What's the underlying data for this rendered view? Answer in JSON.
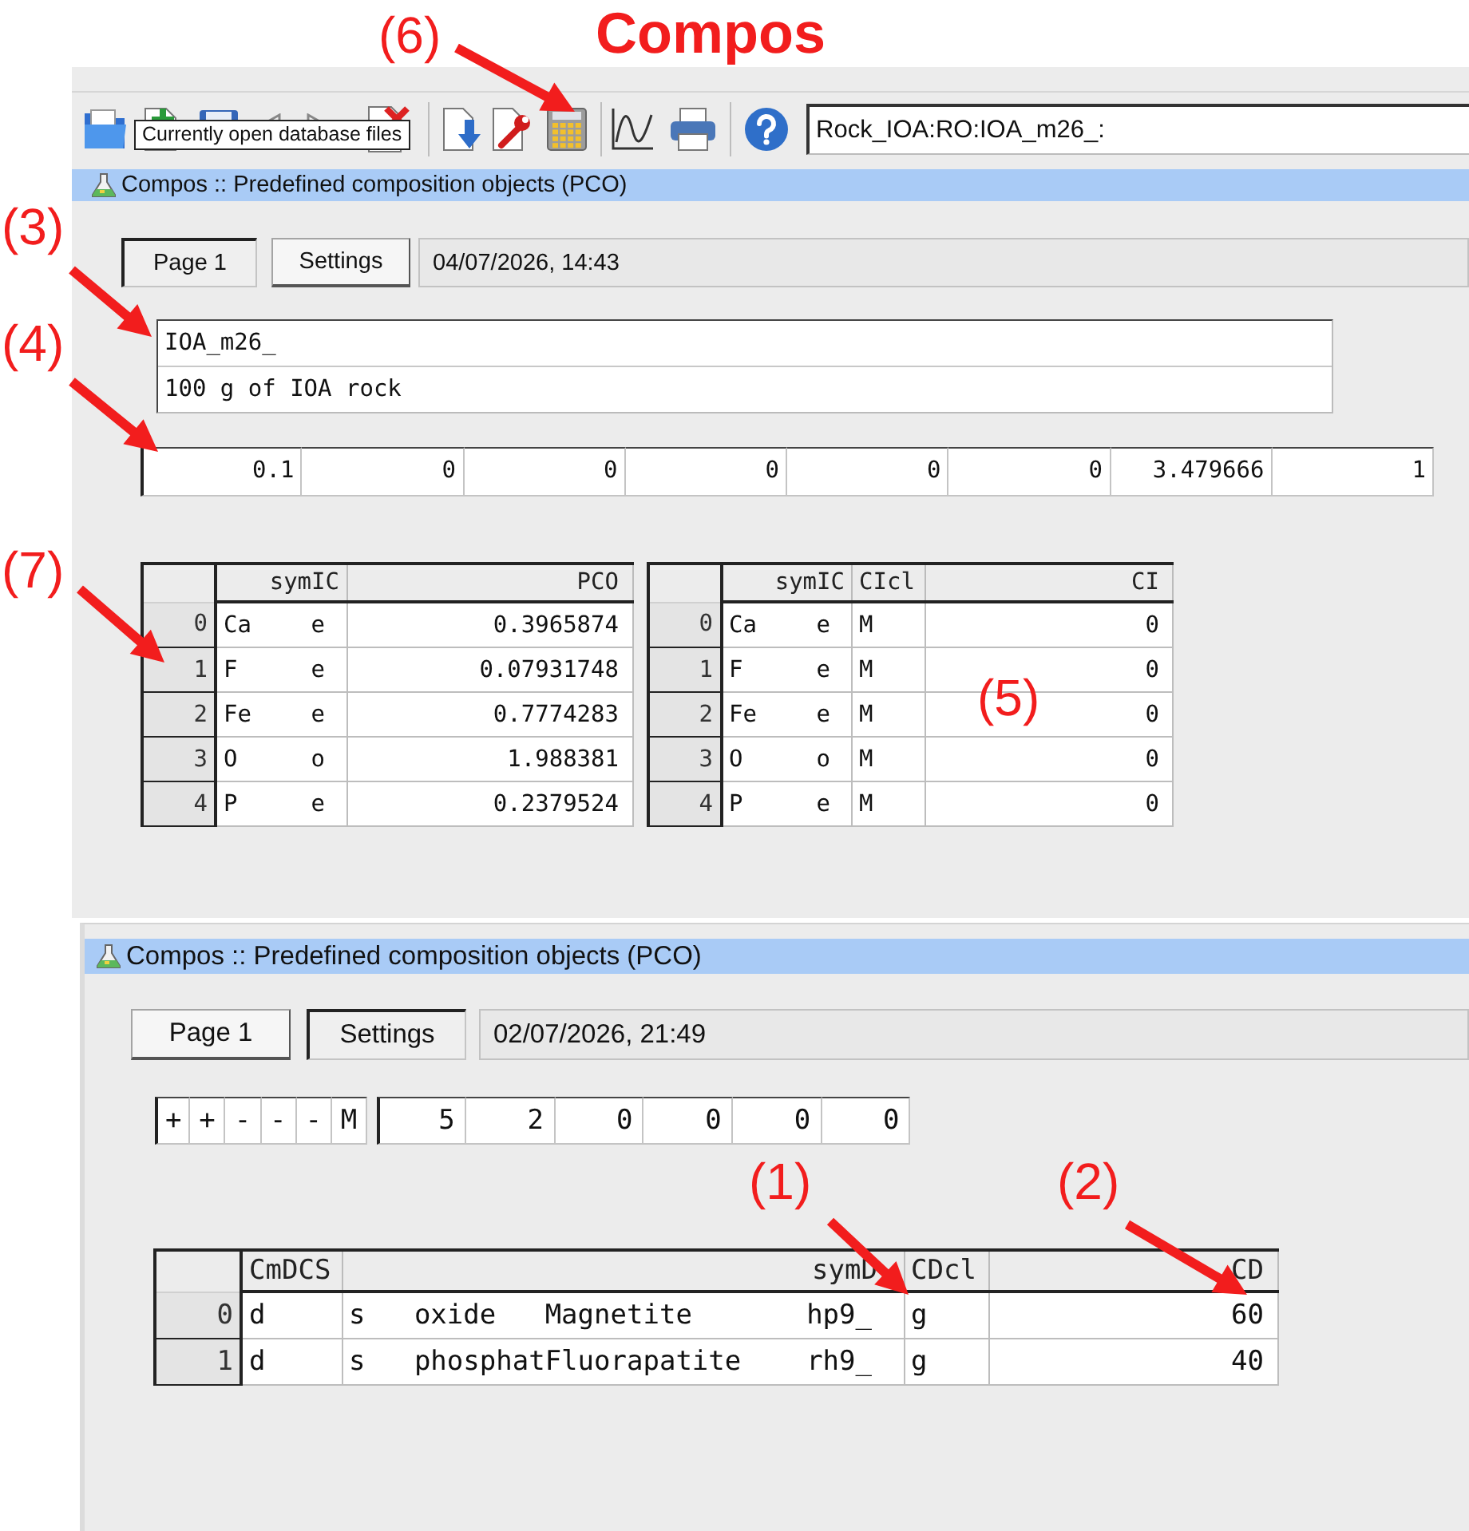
{
  "heading": "Compos",
  "windows": [
    {
      "toolbar": {
        "tooltip": "Currently open database files",
        "path": "Rock_IOA:RO:IOA_m26_:"
      },
      "title": "Compos :: Predefined composition objects (PCO)",
      "tabs": [
        {
          "label": "Page 1",
          "selected": true
        },
        {
          "label": "Settings",
          "selected": false
        }
      ],
      "timestamp": "04/07/2026, 14:43",
      "record_name": "IOA_m26_",
      "comment": "100 g of IOA rock",
      "values": [
        "0.1",
        "0",
        "0",
        "0",
        "0",
        "0",
        "3.479666",
        "1"
      ],
      "tables": [
        {
          "columns": [
            {
              "label": "symIC",
              "kind": "pair"
            },
            {
              "label": "PCO",
              "kind": "number"
            }
          ],
          "rows": [
            {
              "index": "0",
              "cells": [
                [
                  "Ca",
                  "e"
                ],
                "0.3965874"
              ]
            },
            {
              "index": "1",
              "cells": [
                [
                  "F",
                  "e"
                ],
                "0.07931748"
              ]
            },
            {
              "index": "2",
              "cells": [
                [
                  "Fe",
                  "e"
                ],
                "0.7774283"
              ]
            },
            {
              "index": "3",
              "cells": [
                [
                  "O",
                  "o"
                ],
                "1.988381"
              ]
            },
            {
              "index": "4",
              "cells": [
                [
                  "P",
                  "e"
                ],
                "0.2379524"
              ]
            }
          ]
        },
        {
          "columns": [
            {
              "label": "symIC",
              "kind": "pair"
            },
            {
              "label": "CIcl",
              "kind": "text"
            },
            {
              "label": "CI",
              "kind": "number"
            }
          ],
          "rows": [
            {
              "index": "0",
              "cells": [
                [
                  "Ca",
                  "e"
                ],
                "M",
                "0"
              ]
            },
            {
              "index": "1",
              "cells": [
                [
                  "F",
                  "e"
                ],
                "M",
                "0"
              ]
            },
            {
              "index": "2",
              "cells": [
                [
                  "Fe",
                  "e"
                ],
                "M",
                "0"
              ]
            },
            {
              "index": "3",
              "cells": [
                [
                  "O",
                  "o"
                ],
                "M",
                "0"
              ]
            },
            {
              "index": "4",
              "cells": [
                [
                  "P",
                  "e"
                ],
                "M",
                "0"
              ]
            }
          ]
        }
      ],
      "callouts": [
        {
          "label": "(6)",
          "arrow": true
        },
        {
          "label": "(3)",
          "arrow": true
        },
        {
          "label": "(4)",
          "arrow": true
        },
        {
          "label": "(7)",
          "arrow": true
        },
        {
          "label": "(5)",
          "arrow": false
        }
      ]
    },
    {
      "title": "Compos :: Predefined composition objects (PCO)",
      "tabs": [
        {
          "label": "Page 1",
          "selected": false
        },
        {
          "label": "Settings",
          "selected": true
        }
      ],
      "timestamp": "02/07/2026, 21:49",
      "flags": [
        "+",
        "+",
        "-",
        "-",
        "-",
        "M"
      ],
      "values": [
        "5",
        "2",
        "0",
        "0",
        "0",
        "0"
      ],
      "tables": [
        {
          "columns": [
            {
              "label": "CmDCS",
              "kind": "text"
            },
            {
              "label": "symD",
              "kind": "record"
            },
            {
              "label": "CDcl",
              "kind": "text"
            },
            {
              "label": "CD",
              "kind": "number"
            }
          ],
          "rows": [
            {
              "index": "0",
              "cells": [
                "d",
                [
                  "s",
                  "oxide",
                  "Magnetite",
                  "hp9_"
                ],
                "g",
                "60"
              ]
            },
            {
              "index": "1",
              "cells": [
                "d",
                [
                  "s",
                  "phosphat",
                  "Fluorapatite",
                  "rh9_"
                ],
                "g",
                "40"
              ]
            }
          ]
        }
      ],
      "callouts": [
        {
          "label": "(1)",
          "arrow": true
        },
        {
          "label": "(2)",
          "arrow": true
        }
      ]
    }
  ]
}
